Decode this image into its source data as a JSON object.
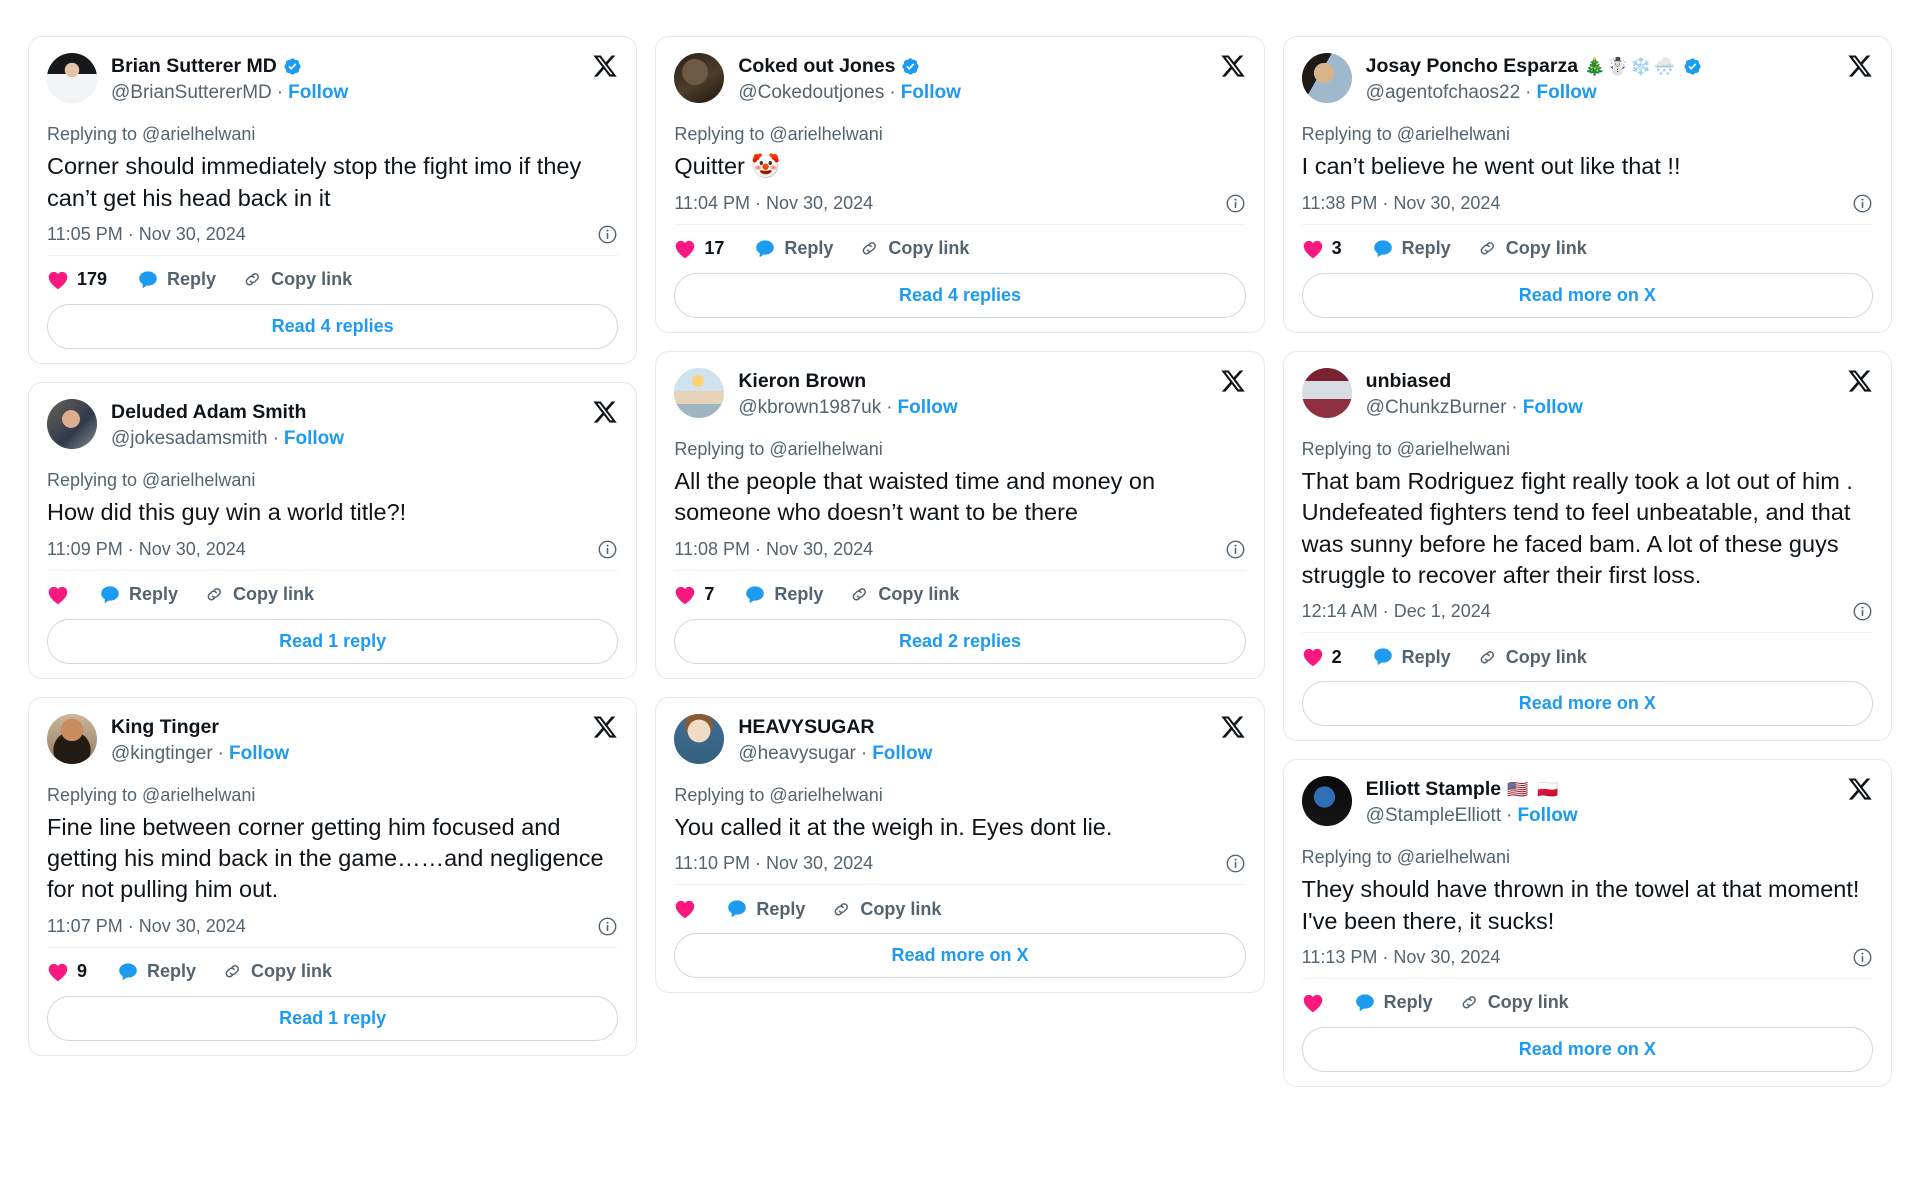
{
  "colors": {
    "brand_blue": "#1d9bf0",
    "like_pink": "#f91880",
    "reply_blue": "#1d9bf0",
    "muted_gray": "#536471",
    "text_black": "#0f1419",
    "card_border": "#e6e8ea"
  },
  "labels": {
    "replying_to": "Replying to @arielhelwani",
    "follow": "Follow",
    "reply": "Reply",
    "copy_link": "Copy link",
    "separator": "·"
  },
  "icons": {
    "x_logo": "x-logo-icon",
    "verified": "verified-badge-icon",
    "info": "info-circle-icon",
    "heart": "heart-icon",
    "reply_bubble": "reply-bubble-icon",
    "copy_link": "link-chain-icon"
  },
  "columns": [
    {
      "id": "column-1",
      "cards": [
        {
          "display_name": "Brian Sutterer MD",
          "verified": true,
          "emojis": "",
          "handle": "@BrianSuttererMD",
          "replying_to": "Replying to @arielhelwani",
          "text": "Corner should immediately stop the fight imo if they can’t get his head back in it",
          "timestamp": "11:05 PM · Nov 30, 2024",
          "like_count": "179",
          "read_more_label": "Read 4 replies",
          "avatar_style": "brian"
        },
        {
          "display_name": "Deluded Adam Smith",
          "verified": false,
          "emojis": "",
          "handle": "@jokesadamsmith",
          "replying_to": "Replying to @arielhelwani",
          "text": "How did this guy win a world title?!",
          "timestamp": "11:09 PM · Nov 30, 2024",
          "like_count": "",
          "read_more_label": "Read 1 reply",
          "avatar_style": "adam"
        },
        {
          "display_name": "King Tinger",
          "verified": false,
          "emojis": "",
          "handle": "@kingtinger",
          "replying_to": "Replying to @arielhelwani",
          "text": "Fine line between corner getting him focused and getting his mind back in the game……and negligence for not pulling him out.",
          "timestamp": "11:07 PM · Nov 30, 2024",
          "like_count": "9",
          "read_more_label": "Read 1 reply",
          "avatar_style": "king"
        }
      ]
    },
    {
      "id": "column-2",
      "cards": [
        {
          "display_name": "Coked out Jones",
          "verified": true,
          "emojis": "",
          "handle": "@Cokedoutjones",
          "replying_to": "Replying to @arielhelwani",
          "text": "Quitter 🤡",
          "timestamp": "11:04 PM · Nov 30, 2024",
          "like_count": "17",
          "read_more_label": "Read 4 replies",
          "avatar_style": "coked"
        },
        {
          "display_name": "Kieron Brown",
          "verified": false,
          "emojis": "",
          "handle": "@kbrown1987uk",
          "replying_to": "Replying to @arielhelwani",
          "text": "All the people that waisted time and money on someone who doesn’t want to be there",
          "timestamp": "11:08 PM · Nov 30, 2024",
          "like_count": "7",
          "read_more_label": "Read 2 replies",
          "avatar_style": "kieron"
        },
        {
          "display_name": "HEAVYSUGAR",
          "verified": false,
          "emojis": "",
          "handle": "@heavysugar",
          "replying_to": "Replying to @arielhelwani",
          "text": "You called it at the weigh in. Eyes dont lie.",
          "timestamp": "11:10 PM · Nov 30, 2024",
          "like_count": "",
          "read_more_label": "Read more on X",
          "avatar_style": "heavy"
        }
      ]
    },
    {
      "id": "column-3",
      "cards": [
        {
          "display_name": "Josay Poncho Esparza",
          "verified": true,
          "emojis": "🎄☃️❄️🌨️",
          "handle": "@agentofchaos22",
          "replying_to": "Replying to @arielhelwani",
          "text": "I can’t believe he went out like that !!",
          "timestamp": "11:38 PM · Nov 30, 2024",
          "like_count": "3",
          "read_more_label": "Read more on X",
          "avatar_style": "josay"
        },
        {
          "display_name": "unbiased",
          "verified": false,
          "emojis": "",
          "handle": "@ChunkzBurner",
          "replying_to": "Replying to @arielhelwani",
          "text": "That bam Rodriguez fight really took a lot out of him . Undefeated fighters tend to feel unbeatable, and that was sunny before he faced bam. A lot of these guys struggle to recover after their first loss.",
          "timestamp": "12:14 AM · Dec 1, 2024",
          "like_count": "2",
          "read_more_label": "Read more on X",
          "avatar_style": "unbiased"
        },
        {
          "display_name": "Elliott Stample",
          "verified": false,
          "emojis": "🇺🇸 🇵🇱",
          "handle": "@StampleElliott",
          "replying_to": "Replying to @arielhelwani",
          "text": "They should have thrown in the towel at that moment! I've been there, it sucks!",
          "timestamp": "11:13 PM · Nov 30, 2024",
          "like_count": "",
          "read_more_label": "Read more on X",
          "avatar_style": "elliott"
        }
      ]
    }
  ]
}
